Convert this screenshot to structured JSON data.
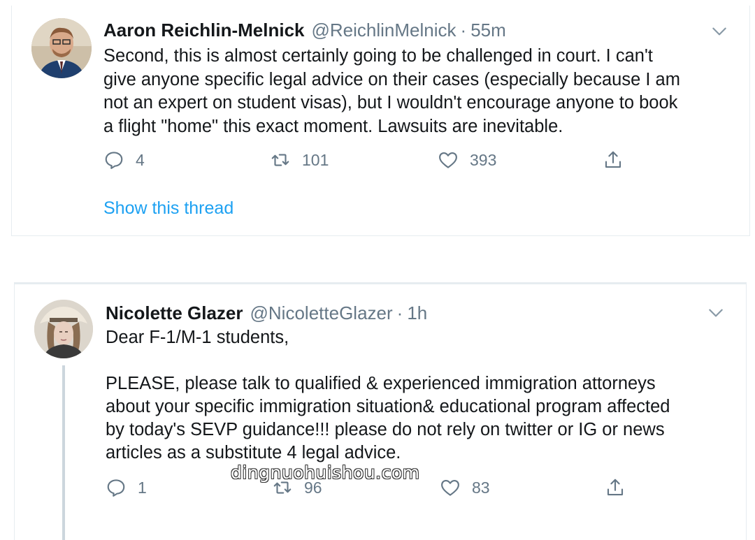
{
  "tweets": [
    {
      "author_name": "Aaron Reichlin-Melnick",
      "handle": "@ReichlinMelnick",
      "separator": "·",
      "time": "55m",
      "text": "Second, this is almost certainly going to be challenged in court. I can't\ngive anyone specific legal advice on their cases (especially because I am\nnot an expert on student visas), but I wouldn't encourage anyone to book\na flight \"home\" this exact moment. Lawsuits are inevitable.",
      "replies": "4",
      "retweets": "101",
      "likes": "393",
      "thread_link": "Show this thread"
    },
    {
      "author_name": "Nicolette Glazer",
      "handle": "@NicoletteGlazer",
      "separator": "·",
      "time": "1h",
      "text": "Dear F-1/M-1 students,\n\nPLEASE, please talk to qualified & experienced immigration attorneys\nabout your specific immigration situation& educational program affected\nby today's SEVP guidance!!! please do not rely on twitter or IG or news\narticles as a substitute 4 legal advice.",
      "replies": "1",
      "retweets": "96",
      "likes": "83"
    }
  ],
  "icons": {
    "reply": "reply-icon",
    "retweet": "retweet-icon",
    "like": "heart-icon",
    "share": "share-icon",
    "more": "chevron-down-icon"
  },
  "colors": {
    "link": "#1da1f2",
    "secondary_text": "#657786",
    "border": "#e6ecf0"
  },
  "watermark": "dingnuohuishou.com"
}
